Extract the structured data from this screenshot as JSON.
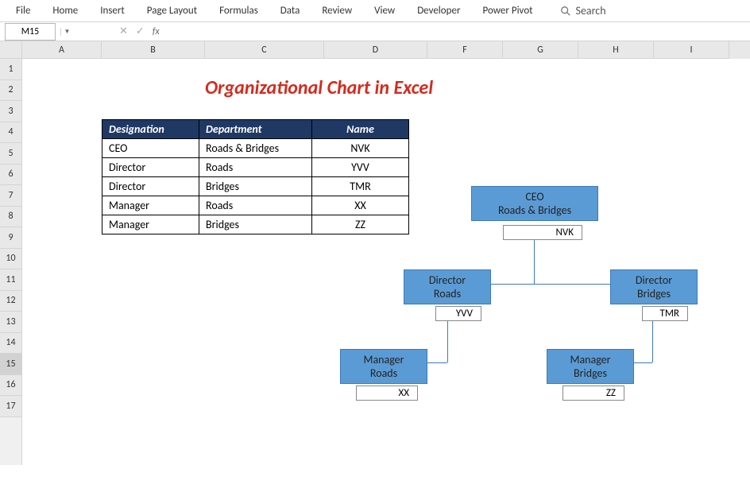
{
  "ribbon": {
    "tabs": [
      "File",
      "Home",
      "Insert",
      "Page Layout",
      "Formulas",
      "Data",
      "Review",
      "View",
      "Developer",
      "Power Pivot"
    ],
    "search_label": "Search"
  },
  "name_box": "M15",
  "fx_label": "fx",
  "columns": [
    "A",
    "B",
    "C",
    "D",
    "F",
    "G",
    "H",
    "I"
  ],
  "rows": [
    "1",
    "2",
    "3",
    "4",
    "5",
    "6",
    "7",
    "8",
    "9",
    "10",
    "11",
    "12",
    "13",
    "14",
    "15",
    "16",
    "17"
  ],
  "selected_row": "15",
  "title": "Organizational Chart in Excel",
  "table": {
    "headers": {
      "designation": "Designation",
      "department": "Department",
      "name": "Name"
    },
    "rows": [
      {
        "designation": "CEO",
        "department": "Roads & Bridges",
        "name": "NVK"
      },
      {
        "designation": "Director",
        "department": "Roads",
        "name": "YVV"
      },
      {
        "designation": "Director",
        "department": "Bridges",
        "name": "TMR"
      },
      {
        "designation": "Manager",
        "department": "Roads",
        "name": "XX"
      },
      {
        "designation": "Manager",
        "department": "Bridges",
        "name": "ZZ"
      }
    ]
  },
  "chart_data": {
    "type": "org-chart",
    "nodes": [
      {
        "id": "ceo",
        "title": "CEO",
        "dept": "Roads & Bridges",
        "name": "NVK",
        "parent": null
      },
      {
        "id": "dir1",
        "title": "Director",
        "dept": "Roads",
        "name": "YVV",
        "parent": "ceo"
      },
      {
        "id": "dir2",
        "title": "Director",
        "dept": "Bridges",
        "name": "TMR",
        "parent": "ceo"
      },
      {
        "id": "mgr1",
        "title": "Manager",
        "dept": "Roads",
        "name": "XX",
        "parent": "dir1"
      },
      {
        "id": "mgr2",
        "title": "Manager",
        "dept": "Bridges",
        "name": "ZZ",
        "parent": "dir2"
      }
    ]
  }
}
